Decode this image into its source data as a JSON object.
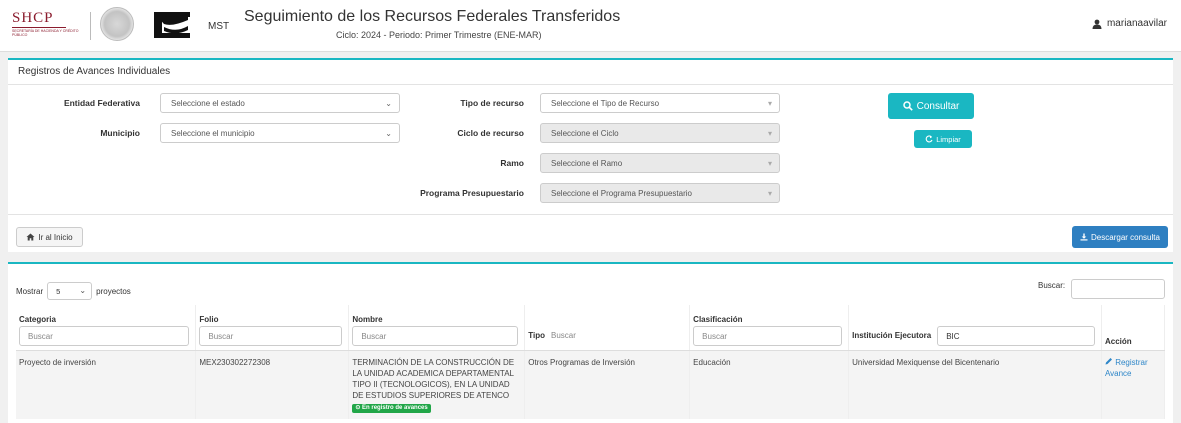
{
  "header": {
    "shcp_text": "SHCP",
    "shcp_subtext": "SECRETARÍA DE HACIENDA Y CRÉDITO PÚBLICO",
    "mst_label": "MST",
    "title": "Seguimiento de los Recursos Federales Transferidos",
    "subtitle": "Ciclo: 2024 - Periodo: Primer Trimestre (ENE-MAR)",
    "username": "marianaavilar"
  },
  "filters": {
    "panel_title": "Registros de Avances Individuales",
    "entidad_label": "Entidad Federativa",
    "entidad_value": "Seleccione el estado",
    "municipio_label": "Municipio",
    "municipio_value": "Seleccione el municipio",
    "tipo_label": "Tipo de recurso",
    "tipo_value": "Seleccione el Tipo de Recurso",
    "ciclo_label": "Ciclo de recurso",
    "ciclo_value": "Seleccione el Ciclo",
    "ramo_label": "Ramo",
    "ramo_value": "Seleccione el Ramo",
    "programa_label": "Programa Presupuestario",
    "programa_value": "Seleccione el Programa Presupuestario",
    "consultar_label": "Consultar",
    "limpiar_label": "Limpiar",
    "inicio_label": "Ir al Inicio",
    "descargar_label": "Descargar consulta"
  },
  "table_controls": {
    "mostrar_label": "Mostrar",
    "page_length": "5",
    "proyectos_label": "proyectos",
    "buscar_label": "Buscar:"
  },
  "table": {
    "columns": {
      "categoria": "Categoria",
      "folio": "Folio",
      "nombre": "Nombre",
      "tipo": "Tipo",
      "clasificacion": "Clasificación",
      "institucion": "Institución Ejecutora",
      "accion": "Acción"
    },
    "filter_placeholder": "Buscar",
    "institucion_filter_value": "BIC",
    "rows": [
      {
        "categoria": "Proyecto de inversión",
        "folio": "MEX230302272308",
        "nombre": "TERMINACIÓN DE LA CONSTRUCCIÓN DE LA UNIDAD ACADEMICA DEPARTAMENTAL TIPO II (TECNOLOGICOS), EN LA UNIDAD DE ESTUDIOS SUPERIORES DE ATENCO",
        "badge": "En registro de avances",
        "tipo": "Otros Programas de Inversión",
        "clasificacion": "Educación",
        "institucion": "Universidad Mexiquense del Bicentenario",
        "accion": "Registrar Avance"
      }
    ]
  },
  "colors": {
    "accent": "#1ab7c2",
    "primary": "#2e7fc1",
    "brand": "#8b1c2e",
    "badge": "#21a648"
  }
}
